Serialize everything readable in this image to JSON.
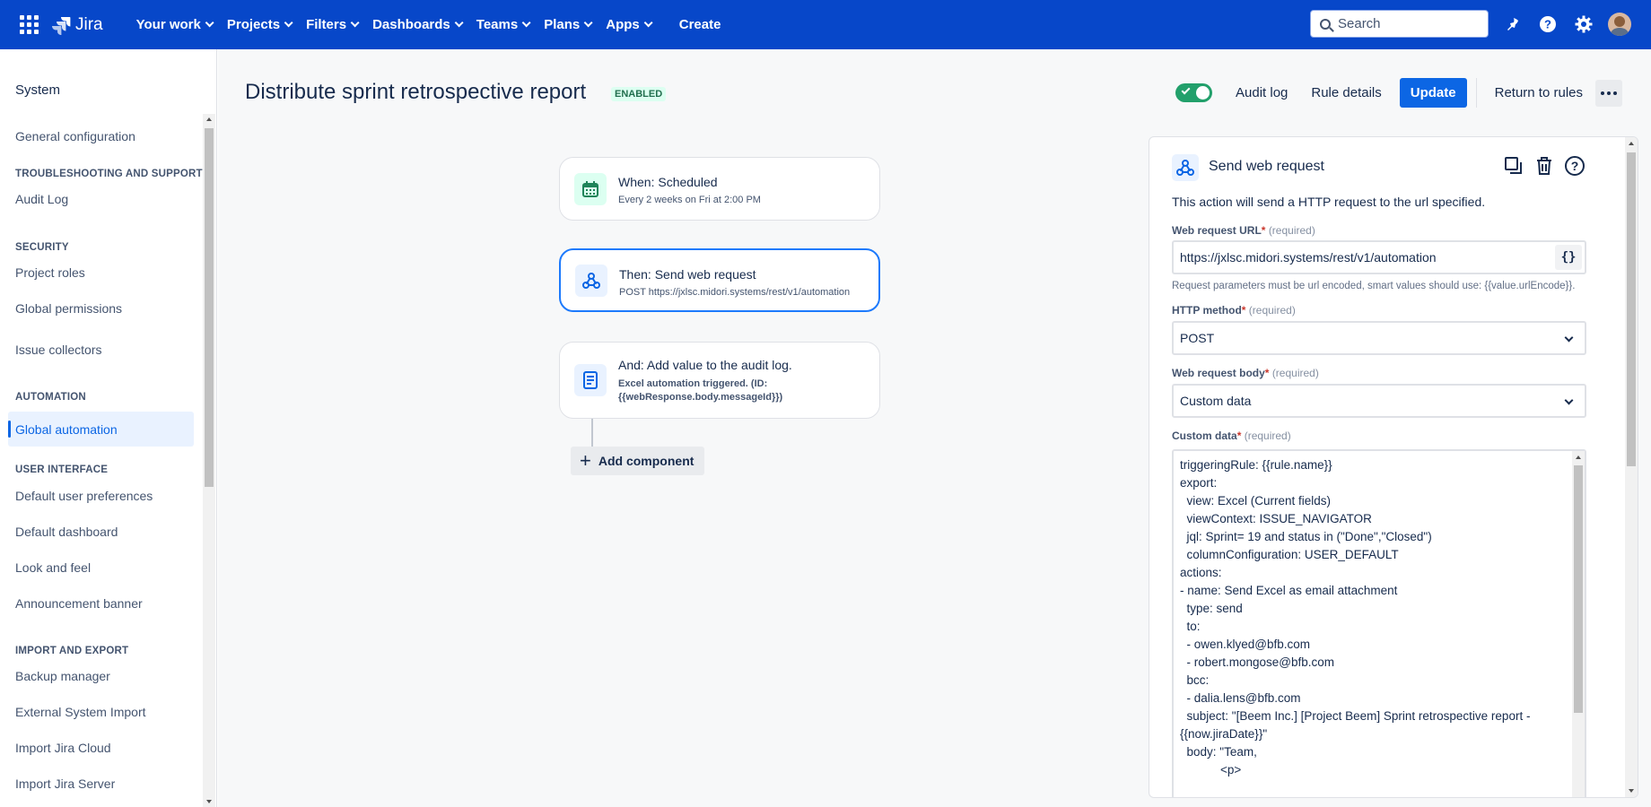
{
  "colors": {
    "nav_bg": "#0747c9",
    "primary": "#0c66e4",
    "enabled_badge": "#216e4e",
    "toggle_on": "#22a06b"
  },
  "topnav": {
    "logo": "Jira",
    "menu": [
      "Your work",
      "Projects",
      "Filters",
      "Dashboards",
      "Teams",
      "Plans",
      "Apps"
    ],
    "create": "Create",
    "search_placeholder": "Search",
    "icons": [
      "notifications-icon",
      "help-icon",
      "settings-icon",
      "avatar"
    ]
  },
  "sidebar": {
    "section": "System",
    "general": "General configuration",
    "headings": {
      "troubleshooting": "Troubleshooting and support",
      "security": "Security",
      "automation": "Automation",
      "ui": "User interface",
      "import": "Import and export"
    },
    "items": {
      "audit_log": "Audit Log",
      "project_roles": "Project roles",
      "global_permissions": "Global permissions",
      "issue_collectors": "Issue collectors",
      "global_automation": "Global automation",
      "default_prefs": "Default user preferences",
      "default_dashboard": "Default dashboard",
      "look_feel": "Look and feel",
      "announcement": "Announcement banner",
      "backup": "Backup manager",
      "external_import": "External System Import",
      "import_cloud": "Import Jira Cloud",
      "import_server": "Import Jira Server"
    }
  },
  "header": {
    "title": "Distribute sprint retrospective report",
    "status": "ENABLED",
    "audit_log": "Audit log",
    "rule_details": "Rule details",
    "update": "Update",
    "return": "Return to rules"
  },
  "flow": {
    "trigger": {
      "title": "When: Scheduled",
      "subtitle": "Every 2 weeks on Fri at 2:00 PM"
    },
    "action": {
      "title": "Then: Send web request",
      "subtitle": "POST https://jxlsc.midori.systems/rest/v1/automation"
    },
    "audit": {
      "title": "And: Add value to the audit log.",
      "line1": "Excel automation triggered. (ID:",
      "line2": "{{webResponse.body.messageId}})"
    },
    "add_component": "Add component"
  },
  "panel": {
    "title": "Send web request",
    "description": "This action will send a HTTP request to the url specified.",
    "url_label": "Web request URL",
    "url_value": "https://jxlsc.midori.systems/rest/v1/automation",
    "braces": "{}",
    "url_hint": "Request parameters must be url encoded, smart values should use: {{value.urlEncode}}.",
    "method_label": "HTTP method",
    "method_value": "POST",
    "body_label": "Web request body",
    "body_value": "Custom data",
    "custom_label": "Custom data",
    "required": "(required)",
    "asterisk": "*",
    "custom_data": "triggeringRule: {{rule.name}}\nexport:\n  view: Excel (Current fields)\n  viewContext: ISSUE_NAVIGATOR\n  jql: Sprint= 19 and status in (\"Done\",\"Closed\")\n  columnConfiguration: USER_DEFAULT\nactions:\n- name: Send Excel as email attachment\n  type: send\n  to:\n  - owen.klyed@bfb.com\n  - robert.mongose@bfb.com\n  bcc:\n  - dalia.lens@bfb.com\n  subject: \"[Beem Inc.] [Project Beem] Sprint retrospective report -\n{{now.jiraDate}}\"\n  body: \"Team,\n            <p>"
  }
}
